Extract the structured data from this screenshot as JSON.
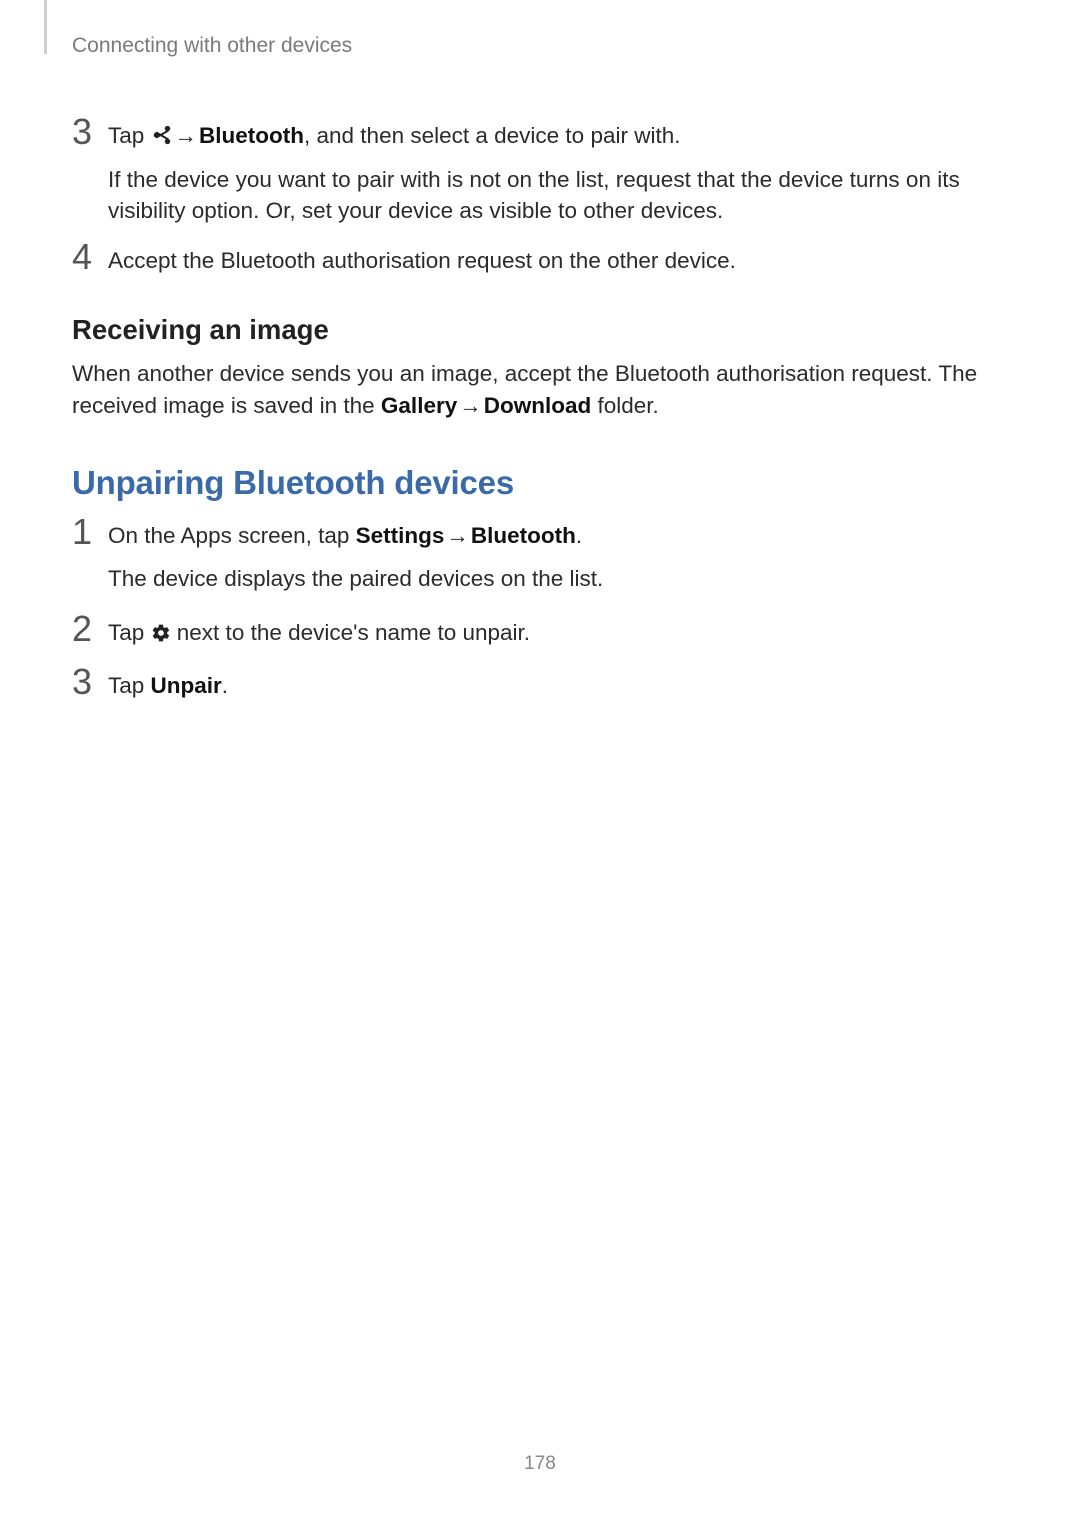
{
  "breadcrumb": "Connecting with other devices",
  "steps_top": {
    "n3": "3",
    "n4": "4",
    "s3_a": "Tap ",
    "s3_arrow": " → ",
    "s3_bold": "Bluetooth",
    "s3_b": ", and then select a device to pair with.",
    "s3_sub": "If the device you want to pair with is not on the list, request that the device turns on its visibility option. Or, set your device as visible to other devices.",
    "s4": "Accept the Bluetooth authorisation request on the other device."
  },
  "subhead": "Receiving an image",
  "receiving_a": "When another device sends you an image, accept the Bluetooth authorisation request. The received image is saved in the ",
  "receiving_bold1": "Gallery",
  "receiving_arrow": " → ",
  "receiving_bold2": "Download",
  "receiving_b": " folder.",
  "section_head": "Unpairing Bluetooth devices",
  "unpair": {
    "n1": "1",
    "n2": "2",
    "n3": "3",
    "s1_a": "On the Apps screen, tap ",
    "s1_bold1": "Settings",
    "s1_arrow": " → ",
    "s1_bold2": "Bluetooth",
    "s1_b": ".",
    "s1_sub": "The device displays the paired devices on the list.",
    "s2_a": "Tap ",
    "s2_b": " next to the device's name to unpair.",
    "s3_a": "Tap ",
    "s3_bold": "Unpair",
    "s3_b": "."
  },
  "page_number": "178"
}
